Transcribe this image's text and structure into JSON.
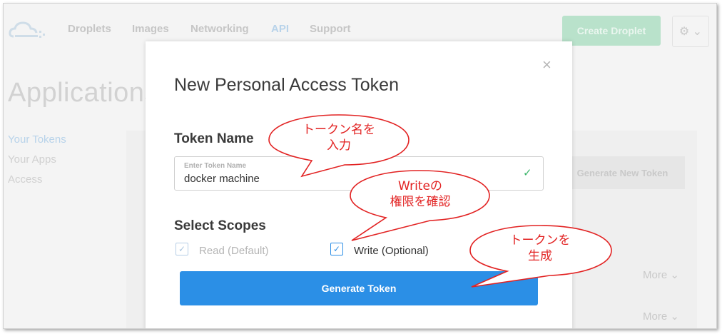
{
  "nav": {
    "items": [
      "Droplets",
      "Images",
      "Networking",
      "API",
      "Support"
    ],
    "create_label": "Create Droplet",
    "gear_caret": "⚙︎ ⌄"
  },
  "page": {
    "title": "Applications",
    "sidebar": [
      "Your Tokens",
      "Your Apps",
      "Access"
    ],
    "generate_new_label": "Generate New Token",
    "more_label": "More"
  },
  "modal": {
    "title": "New Personal Access Token",
    "close": "×",
    "token_section": "Token Name",
    "token_placeholder": "Enter Token Name",
    "token_value": "docker machine",
    "scopes_section": "Select Scopes",
    "scope_read": "Read (Default)",
    "scope_write": "Write (Optional)",
    "generate_label": "Generate Token"
  },
  "callouts": {
    "name": "トークン名を\n入力",
    "write": "Writeの\n権限を確認",
    "generate": "トークンを\n生成"
  },
  "colors": {
    "accent": "#2b8fe6",
    "callout": "#e22222",
    "check_ok": "#3bb56a"
  }
}
